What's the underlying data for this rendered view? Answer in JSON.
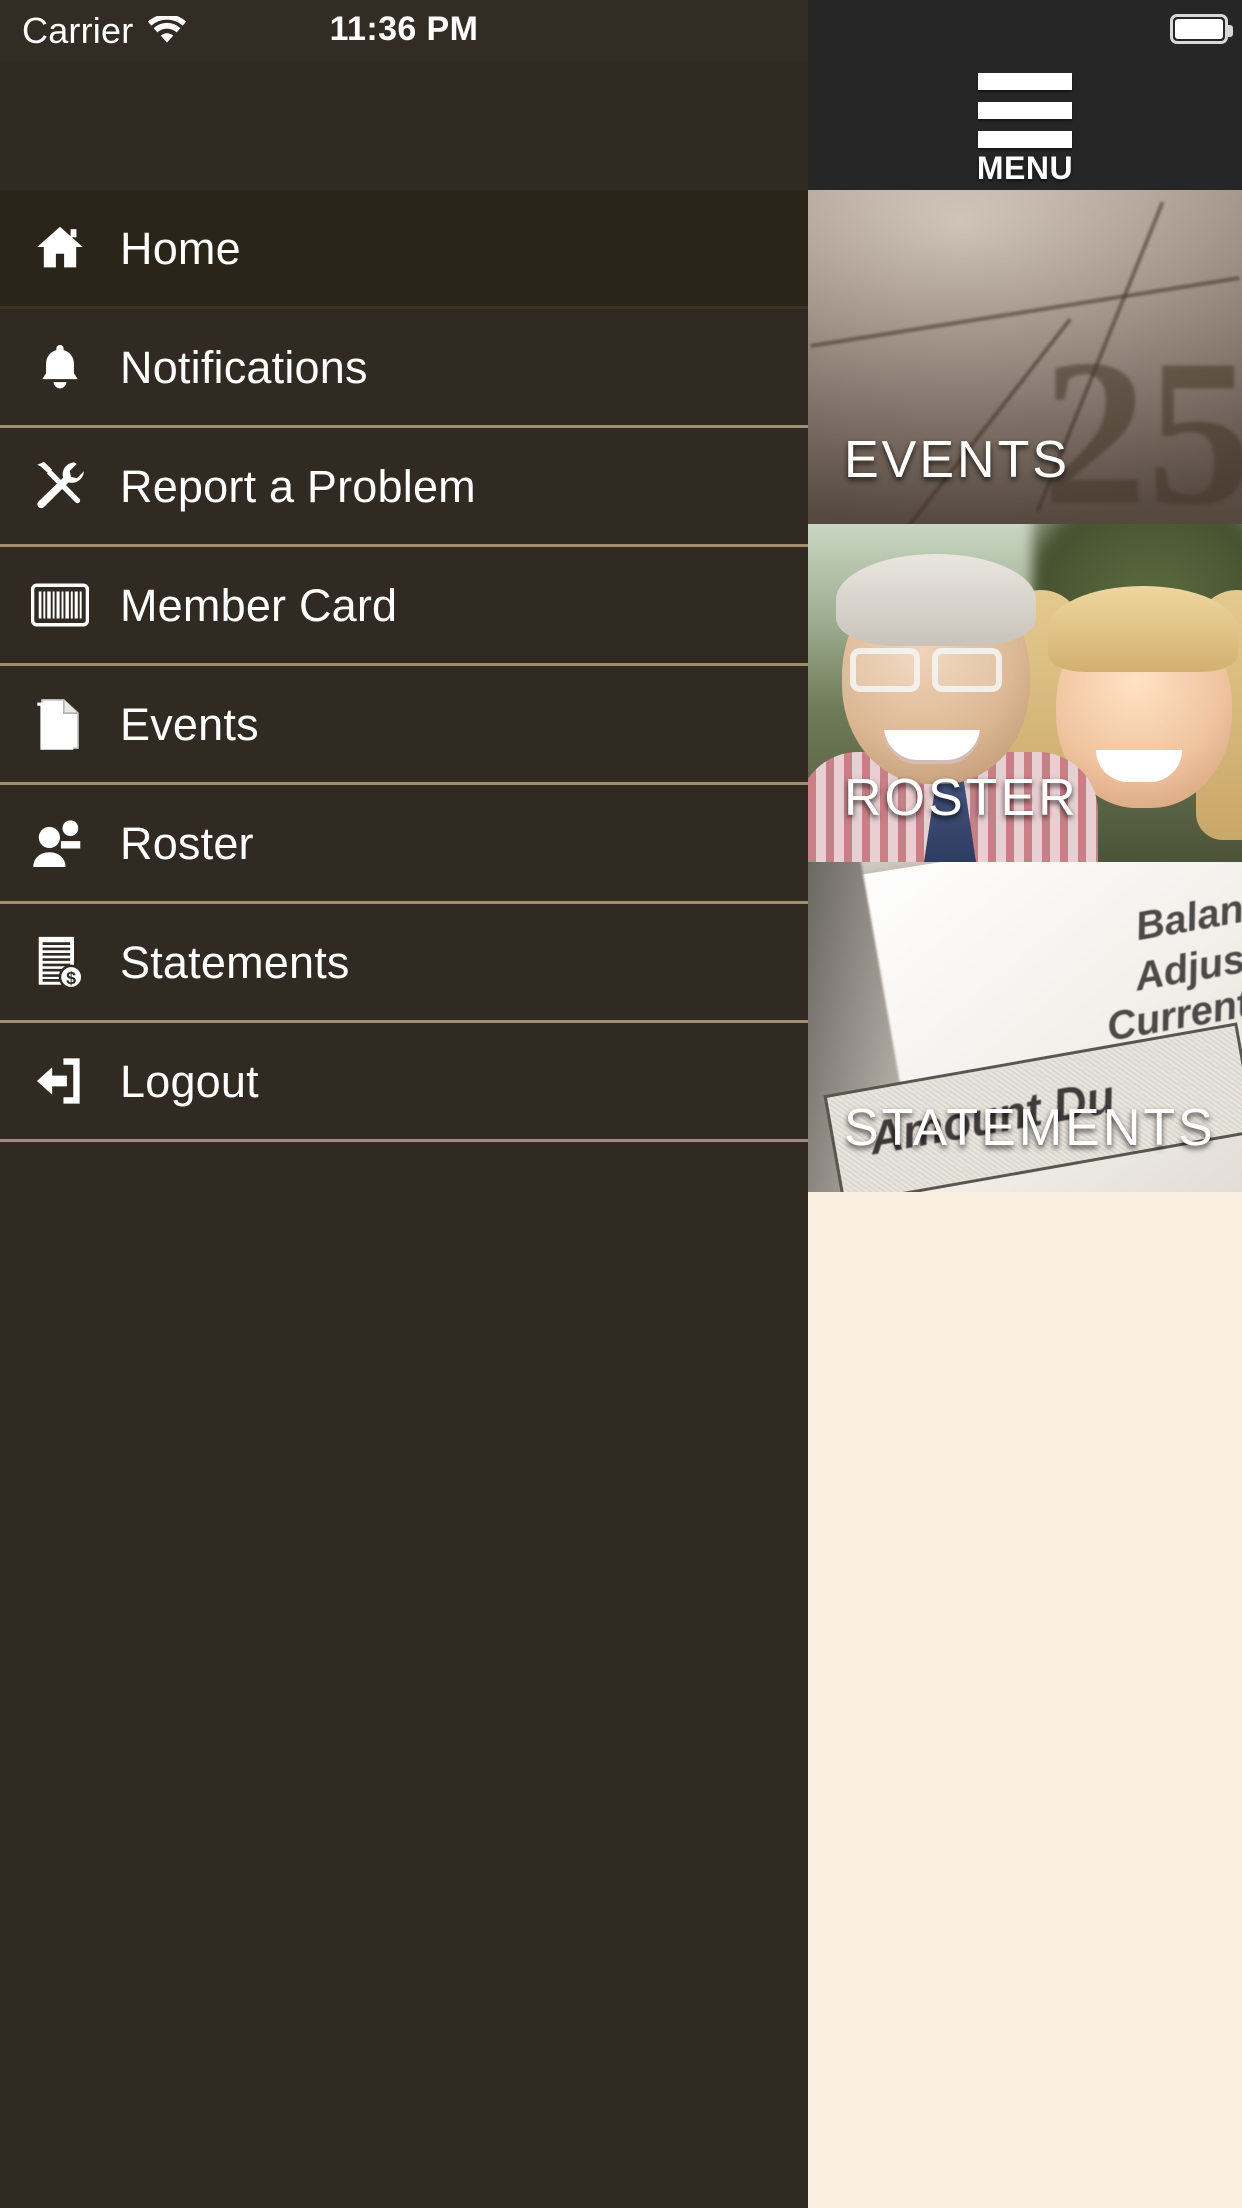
{
  "statusbar": {
    "carrier": "Carrier",
    "wifi_icon": "wifi-icon",
    "time": "11:36 PM",
    "battery_icon": "battery-full-icon"
  },
  "header": {
    "menu_button_label": "MENU",
    "menu_icon": "hamburger-menu-icon"
  },
  "sidebar": {
    "items": [
      {
        "label": "Home",
        "icon": "home-icon",
        "active": true
      },
      {
        "label": "Notifications",
        "icon": "bell-icon",
        "active": false
      },
      {
        "label": "Report a Problem",
        "icon": "tools-icon",
        "active": false
      },
      {
        "label": "Member Card",
        "icon": "barcode-icon",
        "active": false
      },
      {
        "label": "Events",
        "icon": "document-icon",
        "active": false
      },
      {
        "label": "Roster",
        "icon": "people-icon",
        "active": false
      },
      {
        "label": "Statements",
        "icon": "invoice-dollar-icon",
        "active": false
      },
      {
        "label": "Logout",
        "icon": "logout-icon",
        "active": false
      }
    ]
  },
  "main": {
    "tiles": [
      {
        "label": "EVENTS",
        "image": "calendar-photo"
      },
      {
        "label": "ROSTER",
        "image": "members-photo"
      },
      {
        "label": "STATEMENTS",
        "image": "statement-photo"
      }
    ],
    "statement_photo_text": {
      "line1": "Balanc",
      "line2": "Adjustm",
      "line3": "Current P",
      "boxed": "Amount Du"
    }
  },
  "colors": {
    "drawer_bg": "#312a22",
    "drawer_active_bg": "#2a2419",
    "divider": "#a08f6d",
    "header_bg": "#262626",
    "content_bg": "#faeee0",
    "text": "#ffffff"
  }
}
